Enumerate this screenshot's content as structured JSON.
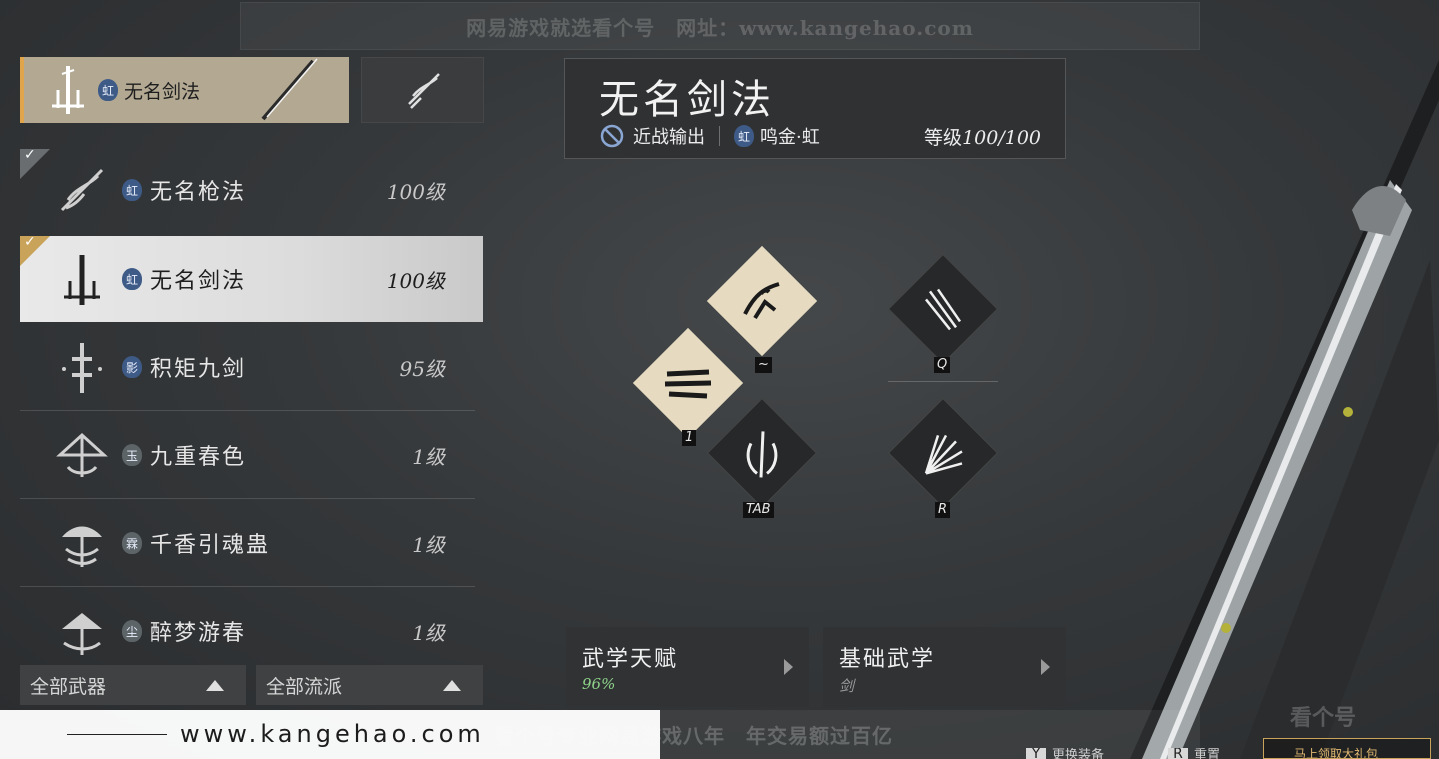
{
  "watermark": {
    "top_text": "网易游戏就选看个号　网址：www.kangehao.com",
    "url": "www.kangehao.com",
    "slogan": "看个号专业网易游戏八年　年交易额过百亿",
    "logo_text": "看个号"
  },
  "weapon_tabs": [
    {
      "badge": "虹",
      "name": "无名剑法",
      "active": true
    },
    {
      "icon": "spear-icon",
      "active": false
    }
  ],
  "martial_list": [
    {
      "badge": "虹",
      "name": "无名枪法",
      "level": "100级",
      "equipped": true
    },
    {
      "badge": "虹",
      "name": "无名剑法",
      "level": "100级",
      "equipped": true,
      "selected": true
    },
    {
      "badge": "影",
      "name": "积矩九剑",
      "level": "95级"
    },
    {
      "badge": "玉",
      "name": "九重春色",
      "level": "1级"
    },
    {
      "badge": "霖",
      "name": "千香引魂蛊",
      "level": "1级"
    },
    {
      "badge": "尘",
      "name": "醉梦游春",
      "level": "1级"
    }
  ],
  "filters": {
    "weapon": "全部武器",
    "school": "全部流派"
  },
  "header": {
    "title": "无名剑法",
    "role": "近战输出",
    "badge": "虹",
    "school": "鸣金·虹",
    "level_label": "等级",
    "level_value": "100/100"
  },
  "skills": [
    {
      "key": "~",
      "style": "light"
    },
    {
      "key": "1",
      "style": "light"
    },
    {
      "key": "TAB",
      "style": "dark"
    },
    {
      "key": "Q",
      "style": "dark"
    },
    {
      "key": "R",
      "style": "dark"
    }
  ],
  "cards": {
    "talent": {
      "title": "武学天赋",
      "value": "96%"
    },
    "basic": {
      "title": "基础武学",
      "value": "剑"
    }
  },
  "hints": [
    {
      "key": "Y",
      "label": "更换装备"
    },
    {
      "key": "R",
      "label": "重置"
    }
  ],
  "corner_button": "马上领取大礼包",
  "colors": {
    "accent": "#e0a44a",
    "talent_value": "#8fd48a",
    "badge_blue": "#3e5a86"
  }
}
